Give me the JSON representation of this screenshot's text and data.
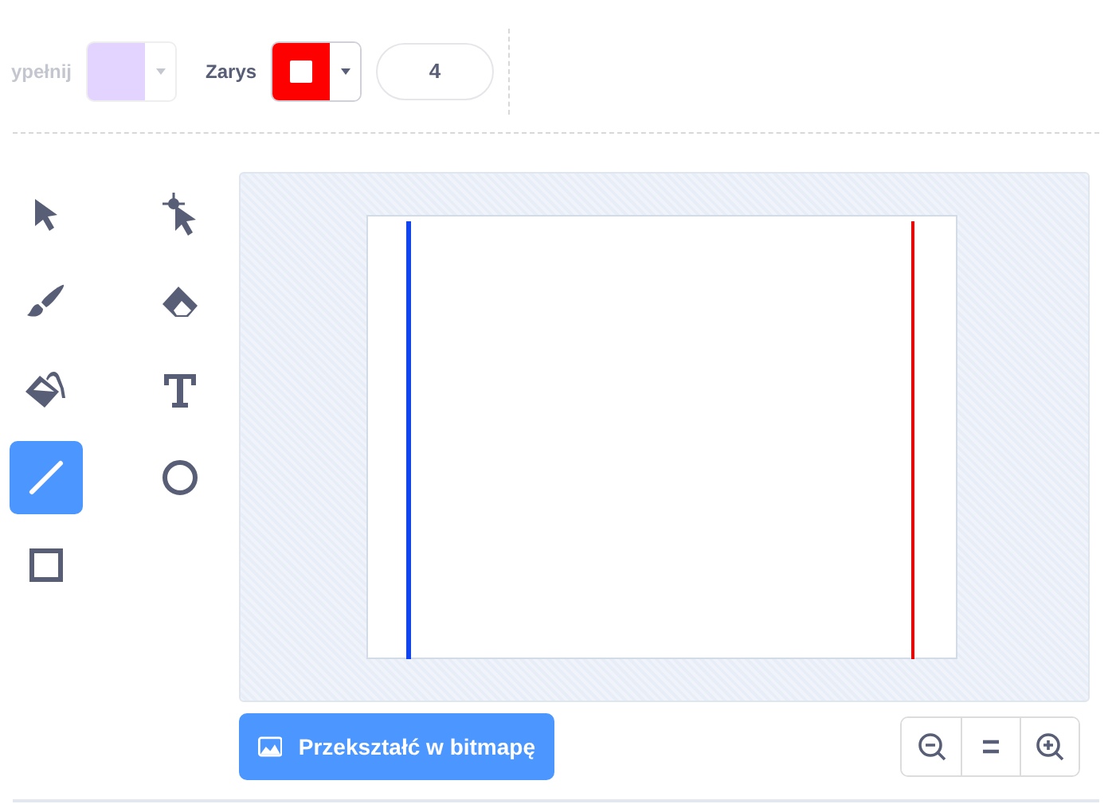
{
  "toolbar": {
    "fill": {
      "label": "ypełnij",
      "color": "#e2d3ff",
      "disabled": true
    },
    "outline": {
      "label": "Zarys",
      "color": "#ff0000",
      "disabled": false
    },
    "stroke_width": {
      "value": "4"
    }
  },
  "tools": [
    {
      "kind": "select",
      "selected": false
    },
    {
      "kind": "reshape",
      "selected": false
    },
    {
      "kind": "brush",
      "selected": false
    },
    {
      "kind": "eraser",
      "selected": false
    },
    {
      "kind": "fill",
      "selected": false
    },
    {
      "kind": "text",
      "selected": false
    },
    {
      "kind": "line",
      "selected": true
    },
    {
      "kind": "circle",
      "selected": false
    },
    {
      "kind": "rect",
      "selected": false
    }
  ],
  "canvas": {
    "strokes": [
      {
        "color": "#1144ee"
      },
      {
        "color": "#e60000"
      }
    ]
  },
  "convert_button": {
    "label": "Przekształć w bitmapę"
  },
  "zoom": [
    {
      "kind": "out"
    },
    {
      "kind": "reset"
    },
    {
      "kind": "in"
    }
  ]
}
